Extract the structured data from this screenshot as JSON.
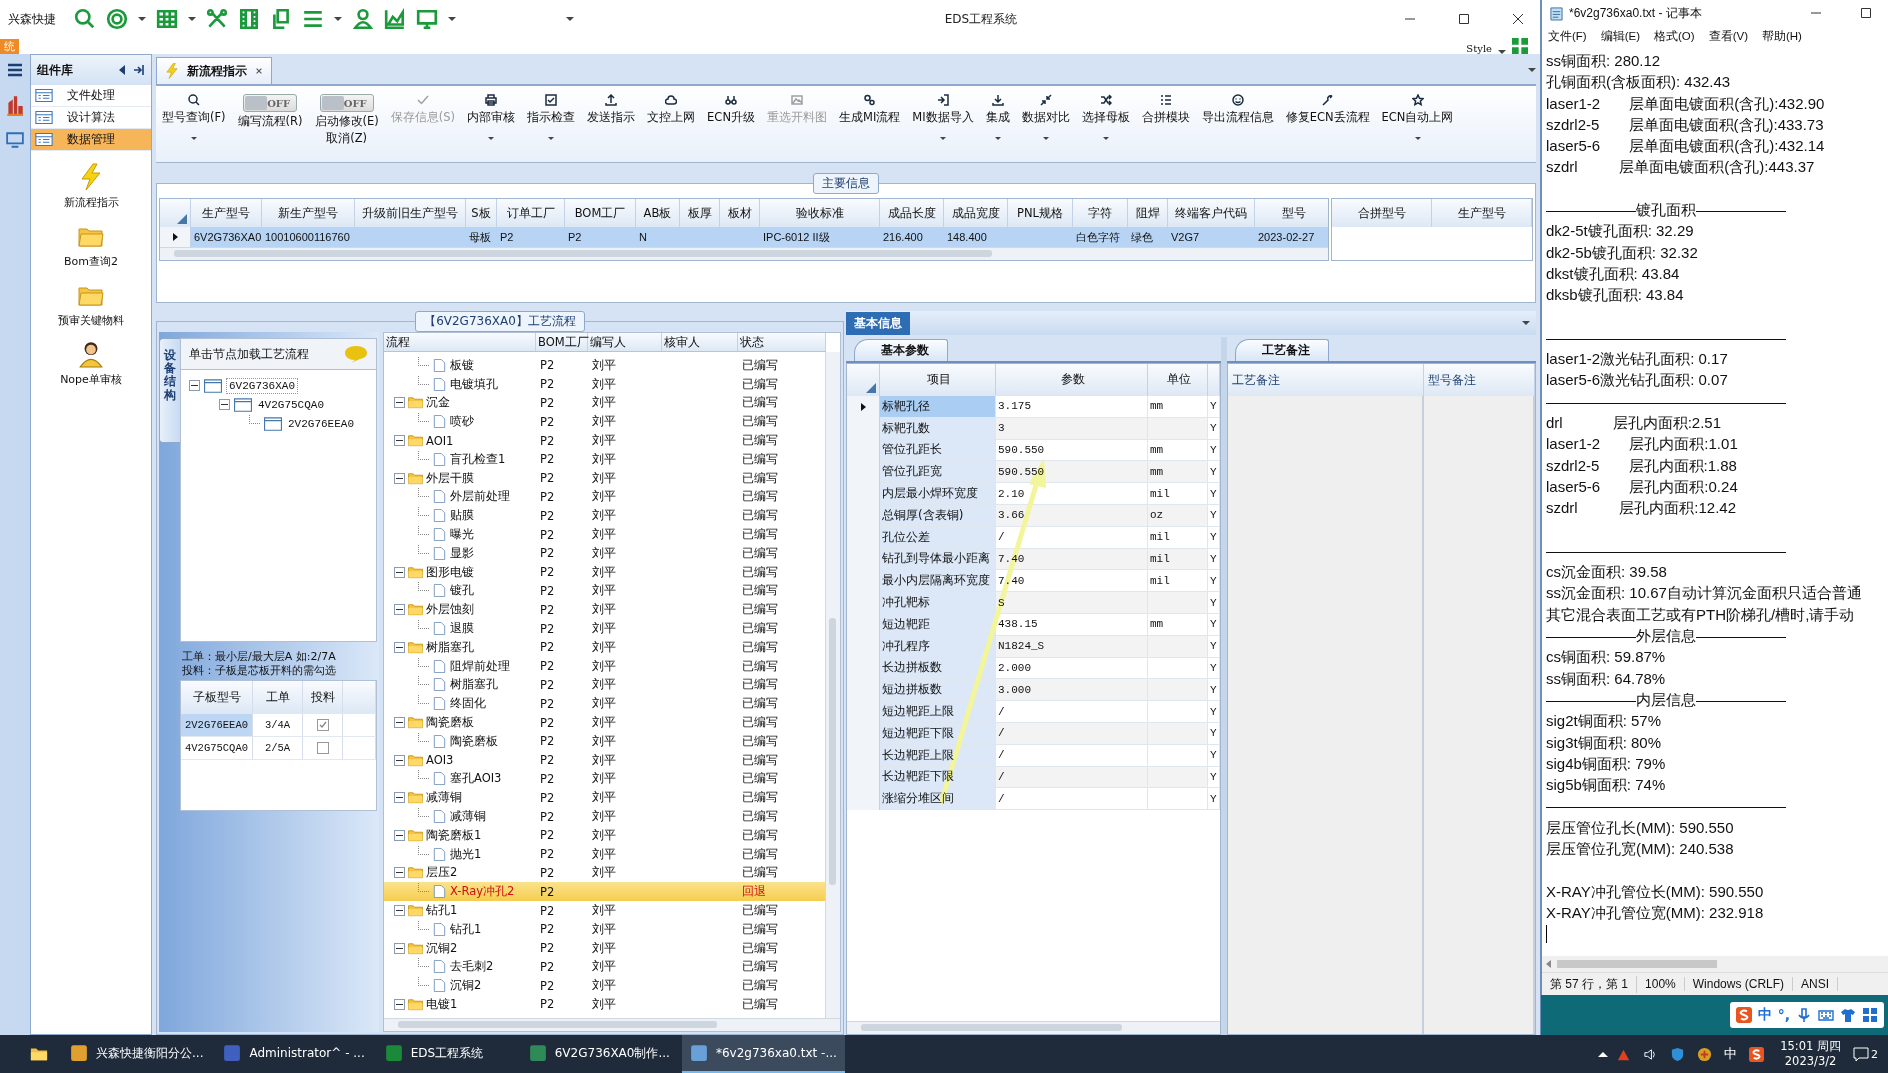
{
  "eds_window": {
    "app_label": "兴森快捷",
    "title": "EDS工程系统",
    "system_tab": "统",
    "style_label": "Style",
    "doc_tab": {
      "label": "新流程指示",
      "selected": true
    },
    "ribbon": [
      {
        "kind": "button",
        "label": "型号查询(F)",
        "dropdown": true,
        "disabled": false
      },
      {
        "kind": "toggle",
        "label": "编写流程(R)",
        "state": "OFF",
        "on": false
      },
      {
        "kind": "toggle",
        "label": "启动修改(E)",
        "label2": "取消(Z)",
        "state": "OFF",
        "on": false
      },
      {
        "kind": "button",
        "label": "保存信息(S)",
        "dropdown": false,
        "disabled": true
      },
      {
        "kind": "button",
        "label": "内部审核",
        "dropdown": true,
        "disabled": false
      },
      {
        "kind": "button",
        "label": "指示检查",
        "dropdown": true,
        "disabled": false
      },
      {
        "kind": "button",
        "label": "发送指示",
        "dropdown": false,
        "disabled": false
      },
      {
        "kind": "button",
        "label": "文控上网",
        "dropdown": false,
        "disabled": false
      },
      {
        "kind": "button",
        "label": "ECN升级",
        "dropdown": false,
        "disabled": false
      },
      {
        "kind": "button",
        "label": "重选开料图",
        "dropdown": false,
        "disabled": true
      },
      {
        "kind": "button",
        "label": "生成MI流程",
        "dropdown": false,
        "disabled": false
      },
      {
        "kind": "button",
        "label": "MI数据导入",
        "dropdown": true,
        "disabled": false
      },
      {
        "kind": "button",
        "label": "集成",
        "dropdown": true,
        "disabled": false
      },
      {
        "kind": "button",
        "label": "数据对比",
        "dropdown": true,
        "disabled": false
      },
      {
        "kind": "button",
        "label": "选择母板",
        "dropdown": true,
        "disabled": false
      },
      {
        "kind": "button",
        "label": "合拼模块",
        "dropdown": false,
        "disabled": false
      },
      {
        "kind": "button",
        "label": "导出流程信息",
        "dropdown": false,
        "disabled": false
      },
      {
        "kind": "button",
        "label": "修复ECN丢流程",
        "dropdown": false,
        "disabled": false
      },
      {
        "kind": "button",
        "label": "ECN自动上网",
        "dropdown": true,
        "disabled": false
      }
    ]
  },
  "component_library": {
    "title": "组件库",
    "items": [
      {
        "label": "文件处理",
        "selected": false
      },
      {
        "label": "设计算法",
        "selected": false
      },
      {
        "label": "数据管理",
        "selected": true
      }
    ],
    "tools": [
      {
        "kind": "lightning",
        "label": "新流程指示"
      },
      {
        "kind": "folder",
        "label": "Bom查询2"
      },
      {
        "kind": "folder",
        "label": "预审关键物料"
      },
      {
        "kind": "user",
        "label": "Nope单审核"
      }
    ]
  },
  "main_info": {
    "title": "主要信息",
    "columns": [
      "生产型号",
      "新生产型号",
      "升级前旧生产型号",
      "S板",
      "订单工厂",
      "BOM工厂",
      "AB板",
      "板厚",
      "板材",
      "验收标准",
      "成品长度",
      "成品宽度",
      "PNL规格",
      "字符",
      "阻焊",
      "终端客户代码",
      "型号"
    ],
    "rows": [
      {
        "selected": true,
        "cells": [
          "6V2G736XA0",
          "10010600116760",
          null,
          "母板",
          "P2",
          "P2",
          "N",
          null,
          null,
          "IPC-6012 II级",
          "216.400",
          "148.400",
          null,
          "白色字符",
          "绿色",
          "V2G7",
          "2023-02-27"
        ]
      }
    ],
    "merge_columns": [
      "合拼型号",
      "生产型号"
    ]
  },
  "process_panel": {
    "title": "【6V2G736XA0】工艺流程",
    "side_tab": "设备结构",
    "hint": "单击节点加载工艺流程",
    "board_tree": [
      {
        "label": "6V2G736XA0",
        "expanded": true,
        "children": [
          {
            "label": "4V2G75CQA0",
            "expanded": true,
            "children": [
              {
                "label": "2V2G76EEA0"
              }
            ]
          }
        ]
      }
    ],
    "note_lines": [
      "工单：最小层/最大层A 如:2/7A",
      "投料：子板是芯板开料的需勾选"
    ],
    "sub_boards": {
      "columns": [
        "子板型号",
        "工单",
        "投料"
      ],
      "rows": [
        {
          "model": "2V2G76EEA0",
          "order": "3/4A",
          "checked": true,
          "selected": true
        },
        {
          "model": "4V2G75CQA0",
          "order": "2/5A",
          "checked": false,
          "selected": false
        }
      ]
    },
    "flow": {
      "columns": [
        "流程",
        "BOM工厂",
        "编写人",
        "核审人",
        "状态"
      ],
      "items": [
        {
          "children": [
            {
              "name": "板镀",
              "factory": "P2",
              "author": "刘平",
              "status": "已编写",
              "selected": false
            },
            {
              "name": "电镀填孔",
              "factory": "P2",
              "author": "刘平",
              "status": "已编写",
              "selected": false
            }
          ]
        },
        {
          "name": "沉金",
          "factory": "P2",
          "author": "刘平",
          "status": "已编写",
          "selected": false,
          "expanded": true,
          "children": [
            {
              "name": "喷砂",
              "factory": "P2",
              "author": "刘平",
              "status": "已编写",
              "selected": false
            }
          ]
        },
        {
          "name": "AOI1",
          "factory": "P2",
          "author": "刘平",
          "status": "已编写",
          "selected": false,
          "expanded": true,
          "children": [
            {
              "name": "盲孔检查1",
              "factory": "P2",
              "author": "刘平",
              "status": "已编写",
              "selected": false
            }
          ]
        },
        {
          "name": "外层干膜",
          "factory": "P2",
          "author": "刘平",
          "status": "已编写",
          "selected": false,
          "expanded": true,
          "children": [
            {
              "name": "外层前处理",
              "factory": "P2",
              "author": "刘平",
              "status": "已编写",
              "selected": false
            },
            {
              "name": "贴膜",
              "factory": "P2",
              "author": "刘平",
              "status": "已编写",
              "selected": false
            },
            {
              "name": "曝光",
              "factory": "P2",
              "author": "刘平",
              "status": "已编写",
              "selected": false
            },
            {
              "name": "显影",
              "factory": "P2",
              "author": "刘平",
              "status": "已编写",
              "selected": false
            }
          ]
        },
        {
          "name": "图形电镀",
          "factory": "P2",
          "author": "刘平",
          "status": "已编写",
          "selected": false,
          "expanded": true,
          "children": [
            {
              "name": "镀孔",
              "factory": "P2",
              "author": "刘平",
              "status": "已编写",
              "selected": false
            }
          ]
        },
        {
          "name": "外层蚀刻",
          "factory": "P2",
          "author": "刘平",
          "status": "已编写",
          "selected": false,
          "expanded": true,
          "children": [
            {
              "name": "退膜",
              "factory": "P2",
              "author": "刘平",
              "status": "已编写",
              "selected": false
            }
          ]
        },
        {
          "name": "树脂塞孔",
          "factory": "P2",
          "author": "刘平",
          "status": "已编写",
          "selected": false,
          "expanded": true,
          "children": [
            {
              "name": "阻焊前处理",
              "factory": "P2",
              "author": "刘平",
              "status": "已编写",
              "selected": false
            },
            {
              "name": "树脂塞孔",
              "factory": "P2",
              "author": "刘平",
              "status": "已编写",
              "selected": false
            },
            {
              "name": "终固化",
              "factory": "P2",
              "author": "刘平",
              "status": "已编写",
              "selected": false
            }
          ]
        },
        {
          "name": "陶瓷磨板",
          "factory": "P2",
          "author": "刘平",
          "status": "已编写",
          "selected": false,
          "expanded": true,
          "children": [
            {
              "name": "陶瓷磨板",
              "factory": "P2",
              "author": "刘平",
              "status": "已编写",
              "selected": false
            }
          ]
        },
        {
          "name": "AOI3",
          "factory": "P2",
          "author": "刘平",
          "status": "已编写",
          "selected": false,
          "expanded": true,
          "children": [
            {
              "name": "塞孔AOI3",
              "factory": "P2",
              "author": "刘平",
              "status": "已编写",
              "selected": false
            }
          ]
        },
        {
          "name": "减薄铜",
          "factory": "P2",
          "author": "刘平",
          "status": "已编写",
          "selected": false,
          "expanded": true,
          "children": [
            {
              "name": "减薄铜",
              "factory": "P2",
              "author": "刘平",
              "status": "已编写",
              "selected": false
            }
          ]
        },
        {
          "name": "陶瓷磨板1",
          "factory": "P2",
          "author": "刘平",
          "status": "已编写",
          "selected": false,
          "expanded": true,
          "children": [
            {
              "name": "抛光1",
              "factory": "P2",
              "author": "刘平",
              "status": "已编写",
              "selected": false
            }
          ]
        },
        {
          "name": "层压2",
          "factory": "P2",
          "author": "刘平",
          "status": "已编写",
          "selected": false,
          "expanded": true,
          "children": [
            {
              "name": "X-Ray冲孔2",
              "factory": "P2",
              "status": "回退",
              "selected": true
            }
          ]
        },
        {
          "name": "钻孔1",
          "factory": "P2",
          "author": "刘平",
          "status": "已编写",
          "selected": false,
          "expanded": true,
          "children": [
            {
              "name": "钻孔1",
              "factory": "P2",
              "author": "刘平",
              "status": "已编写",
              "selected": false
            }
          ]
        },
        {
          "name": "沉铜2",
          "factory": "P2",
          "author": "刘平",
          "status": "已编写",
          "selected": false,
          "expanded": true,
          "children": [
            {
              "name": "去毛刺2",
              "factory": "P2",
              "author": "刘平",
              "status": "已编写",
              "selected": false
            },
            {
              "name": "沉铜2",
              "factory": "P2",
              "author": "刘平",
              "status": "已编写",
              "selected": false
            }
          ]
        },
        {
          "name": "电镀1",
          "factory": "P2",
          "author": "刘平",
          "status": "已编写",
          "selected": false,
          "expanded": true
        }
      ]
    }
  },
  "params_panel": {
    "title": "基本信息",
    "tab": "基本参数",
    "columns": [
      "项目",
      "参数",
      "单位"
    ],
    "rows": [
      {
        "item": "标靶孔径",
        "value": "3.175",
        "unit": "mm",
        "flag": "Y",
        "selected": true
      },
      {
        "item": "标靶孔数",
        "value": "3",
        "flag": "Y",
        "selected": false
      },
      {
        "item": "管位孔距长",
        "value": "590.550",
        "unit": "mm",
        "flag": "Y",
        "selected": false
      },
      {
        "item": "管位孔距宽",
        "value": "590.550",
        "unit": "mm",
        "flag": "Y",
        "selected": false
      },
      {
        "item": "内层最小焊环宽度",
        "value": "2.10",
        "unit": "mil",
        "flag": "Y",
        "selected": false
      },
      {
        "item": "总铜厚(含表铜)",
        "value": "3.66",
        "unit": "oz",
        "flag": "Y",
        "selected": false
      },
      {
        "item": "孔位公差",
        "value": "/",
        "unit": "mil",
        "flag": "Y",
        "selected": false
      },
      {
        "item": "钻孔到导体最小距离",
        "value": "7.40",
        "unit": "mil",
        "flag": "Y",
        "selected": false
      },
      {
        "item": "最小内层隔离环宽度",
        "value": "7.40",
        "unit": "mil",
        "flag": "Y",
        "selected": false
      },
      {
        "item": "冲孔靶标",
        "value": "S",
        "flag": "Y",
        "selected": false
      },
      {
        "item": "短边靶距",
        "value": "438.15",
        "unit": "mm",
        "flag": "Y",
        "selected": false
      },
      {
        "item": "冲孔程序",
        "value": "N1824_S",
        "flag": "Y",
        "selected": false
      },
      {
        "item": "长边拼板数",
        "value": "2.000",
        "flag": "Y",
        "selected": false
      },
      {
        "item": "短边拼板数",
        "value": "3.000",
        "flag": "Y",
        "selected": false
      },
      {
        "item": "短边靶距上限",
        "value": "/",
        "flag": "Y",
        "selected": false
      },
      {
        "item": "短边靶距下限",
        "value": "/",
        "flag": "Y",
        "selected": false
      },
      {
        "item": "长边靶距上限",
        "value": "/",
        "flag": "Y",
        "selected": false
      },
      {
        "item": "长边靶距下限",
        "value": "/",
        "flag": "Y",
        "selected": false
      },
      {
        "item": "涨缩分堆区间",
        "value": "/",
        "flag": "Y",
        "selected": false
      }
    ]
  },
  "notes_panel": {
    "tab": "工艺备注",
    "columns": [
      "工艺备注",
      "型号备注"
    ]
  },
  "notepad": {
    "title": "*6v2g736xa0.txt - 记事本",
    "menu": [
      "文件(F)",
      "编辑(E)",
      "格式(O)",
      "查看(V)",
      "帮助(H)"
    ],
    "lines": [
      {
        "text": "ss铜面积: 280.12",
        "gap_before": false
      },
      {
        "text": "孔铜面积(含板面积): 432.43",
        "gap_before": false
      },
      {
        "text": "laser1-2       层单面电镀面积(含孔):432.90",
        "gap_before": false
      },
      {
        "text": "szdrl2-5       层单面电镀面积(含孔):433.73",
        "gap_before": false
      },
      {
        "text": "laser5-6       层单面电镀面积(含孔):432.14",
        "gap_before": false
      },
      {
        "text": "szdrl          层单面电镀面积(含孔):443.37",
        "gap_before": false
      },
      {
        "text": "——————镀孔面积——————",
        "gap_before": true
      },
      {
        "text": "dk2-5t镀孔面积: 32.29",
        "gap_before": false
      },
      {
        "text": "dk2-5b镀孔面积: 32.32",
        "gap_before": false
      },
      {
        "text": "dkst镀孔面积: 43.84",
        "gap_before": false
      },
      {
        "text": "dksb镀孔面积: 43.84",
        "gap_before": false
      },
      {
        "text": "————————————————",
        "gap_before": true
      },
      {
        "text": "laser1-2激光钻孔面积: 0.17",
        "gap_before": false
      },
      {
        "text": "laser5-6激光钻孔面积: 0.07",
        "gap_before": false
      },
      {
        "text": "————————————————",
        "gap_before": false
      },
      {
        "text": "drl            层孔内面积:2.51",
        "gap_before": false
      },
      {
        "text": "laser1-2       层孔内面积:1.01",
        "gap_before": false
      },
      {
        "text": "szdrl2-5       层孔内面积:1.88",
        "gap_before": false
      },
      {
        "text": "laser5-6       层孔内面积:0.24",
        "gap_before": false
      },
      {
        "text": "szdrl          层孔内面积:12.42",
        "gap_before": false
      },
      {
        "text": "————————————————",
        "gap_before": true
      },
      {
        "text": "cs沉金面积: 39.58",
        "gap_before": false
      },
      {
        "text": "ss沉金面积: 10.67自动计算沉金面积只适合普通",
        "gap_before": false
      },
      {
        "text": "其它混合表面工艺或有PTH阶梯孔/槽时,请手动",
        "gap_before": false
      },
      {
        "text": "——————外层信息——————",
        "gap_before": false
      },
      {
        "text": "cs铜面积: 59.87%",
        "gap_before": false
      },
      {
        "text": "ss铜面积: 64.78%",
        "gap_before": false
      },
      {
        "text": "——————内层信息——————",
        "gap_before": false
      },
      {
        "text": "sig2t铜面积: 57%",
        "gap_before": false
      },
      {
        "text": "sig3t铜面积: 80%",
        "gap_before": false
      },
      {
        "text": "sig4b铜面积: 79%",
        "gap_before": false
      },
      {
        "text": "sig5b铜面积: 74%",
        "gap_before": false
      },
      {
        "text": "————————————————",
        "gap_before": false
      },
      {
        "text": "层压管位孔长(MM): 590.550",
        "gap_before": false
      },
      {
        "text": "层压管位孔宽(MM): 240.538",
        "gap_before": false
      },
      {
        "text": "X-RAY冲孔管位长(MM): 590.550",
        "gap_before": true
      },
      {
        "text": "X-RAY冲孔管位宽(MM): 232.918",
        "gap_before": false
      }
    ],
    "status": [
      "第 57 行，第 1",
      "100%",
      "Windows (CRLF)",
      "ANSI"
    ]
  },
  "ime_bar": {
    "mode": "中",
    "punctuation": "°,"
  },
  "taskbar": {
    "apps": [
      {
        "kind": "browser",
        "label": "兴森快捷衡阳分公...",
        "active": false
      },
      {
        "kind": "disk",
        "label": "Administrator^ - ...",
        "active": false
      },
      {
        "kind": "eds",
        "label": "EDS工程系统",
        "active": false
      },
      {
        "kind": "sheet",
        "label": "6V2G736XA0制作...",
        "active": false
      },
      {
        "kind": "notepad",
        "label": "*6v2g736xa0.txt -...",
        "active": true
      }
    ],
    "ime": "中",
    "time": "15:01 周四",
    "date": "2023/3/2",
    "notifications": "2"
  }
}
